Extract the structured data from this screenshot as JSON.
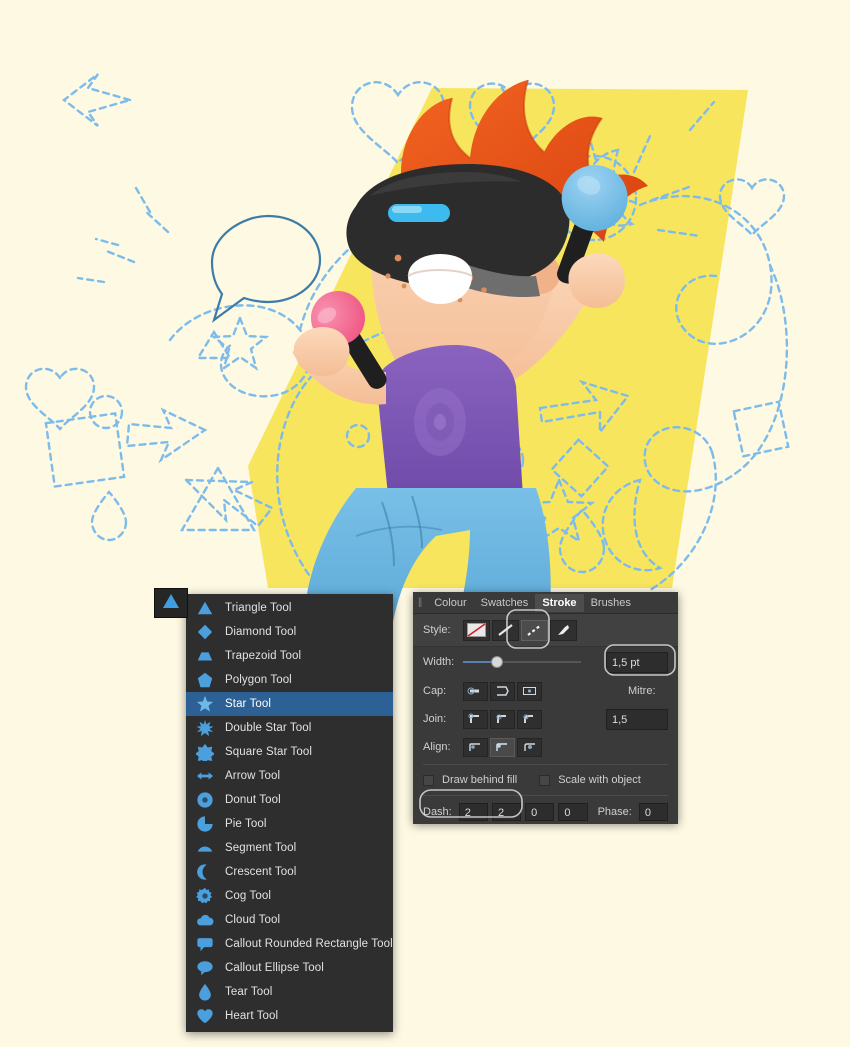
{
  "app": {
    "background_color": "#fdf9e3",
    "accent_yellow": "#f7e35a",
    "dash_stroke_color": "#79b8e8"
  },
  "illustration": {
    "name": "vr-kid-illustration",
    "alt": "Cartoon red-haired boy wearing a VR headset holding two maracas on a yellow backdrop with dashed vector shapes",
    "colors": {
      "backdrop": "#f7e35a",
      "hair": "#e8521f",
      "skin": "#f7c9a8",
      "shirt": "#7e58b5",
      "jeans": "#6bb6e0",
      "headset": "#2b2b2b",
      "visor": "#39b7e8",
      "maraca_pink": "#f2688f",
      "maraca_blue": "#6fbce8",
      "dashes": "#79b8e8"
    }
  },
  "tool_button": {
    "name": "shape-tool-button",
    "icon": "triangle-icon",
    "tooltip": "Triangle Tool"
  },
  "tool_menu": {
    "name": "shape-tools-flyout",
    "selected": "Star Tool",
    "items": [
      {
        "label": "Triangle Tool",
        "icon": "triangle-icon",
        "selected": false
      },
      {
        "label": "Diamond Tool",
        "icon": "diamond-icon",
        "selected": false
      },
      {
        "label": "Trapezoid Tool",
        "icon": "trapezoid-icon",
        "selected": false
      },
      {
        "label": "Polygon Tool",
        "icon": "pentagon-icon",
        "selected": false
      },
      {
        "label": "Star Tool",
        "icon": "star-icon",
        "selected": true
      },
      {
        "label": "Double Star Tool",
        "icon": "double-star-icon",
        "selected": false
      },
      {
        "label": "Square Star Tool",
        "icon": "square-star-icon",
        "selected": false
      },
      {
        "label": "Arrow Tool",
        "icon": "arrow-icon",
        "selected": false
      },
      {
        "label": "Donut Tool",
        "icon": "donut-icon",
        "selected": false
      },
      {
        "label": "Pie Tool",
        "icon": "pie-icon",
        "selected": false
      },
      {
        "label": "Segment Tool",
        "icon": "segment-icon",
        "selected": false
      },
      {
        "label": "Crescent Tool",
        "icon": "crescent-icon",
        "selected": false
      },
      {
        "label": "Cog Tool",
        "icon": "cog-icon",
        "selected": false
      },
      {
        "label": "Cloud Tool",
        "icon": "cloud-icon",
        "selected": false
      },
      {
        "label": "Callout Rounded Rectangle Tool",
        "icon": "callout-rounded-rect-icon",
        "selected": false
      },
      {
        "label": "Callout Ellipse Tool",
        "icon": "callout-ellipse-icon",
        "selected": false
      },
      {
        "label": "Tear Tool",
        "icon": "tear-icon",
        "selected": false
      },
      {
        "label": "Heart Tool",
        "icon": "heart-icon",
        "selected": false
      }
    ]
  },
  "stroke_panel": {
    "name": "stroke-panel",
    "tabs": [
      {
        "label": "Colour",
        "active": false
      },
      {
        "label": "Swatches",
        "active": false
      },
      {
        "label": "Stroke",
        "active": true
      },
      {
        "label": "Brushes",
        "active": false
      }
    ],
    "style": {
      "label": "Style:",
      "options": [
        {
          "name": "no-stroke-style",
          "active": false
        },
        {
          "name": "solid-stroke-style",
          "active": false
        },
        {
          "name": "dashed-stroke-style",
          "active": true
        },
        {
          "name": "brush-stroke-style",
          "active": false
        }
      ]
    },
    "width": {
      "label": "Width:",
      "value": "1,5 pt",
      "slider_percent": 28
    },
    "cap": {
      "label": "Cap:",
      "options": [
        {
          "name": "butt-cap",
          "active": false
        },
        {
          "name": "round-cap",
          "active": false
        },
        {
          "name": "square-cap",
          "active": false
        }
      ]
    },
    "join": {
      "label": "Join:",
      "options": [
        {
          "name": "miter-join",
          "active": false
        },
        {
          "name": "round-join",
          "active": false
        },
        {
          "name": "bevel-join",
          "active": false
        }
      ]
    },
    "align": {
      "label": "Align:",
      "options": [
        {
          "name": "align-center",
          "active": false
        },
        {
          "name": "align-inside",
          "active": true
        },
        {
          "name": "align-outside",
          "active": false
        }
      ]
    },
    "mitre": {
      "label": "Mitre:",
      "value": "1,5"
    },
    "checkboxes": [
      {
        "label": "Draw behind fill",
        "checked": false
      },
      {
        "label": "Scale with object",
        "checked": false
      }
    ],
    "dash": {
      "label": "Dash:",
      "values": [
        "2",
        "2",
        "0",
        "0"
      ],
      "phase_label": "Phase:",
      "phase_value": "0"
    },
    "highlighted_controls": [
      "dashed-stroke-style",
      "width-value-field",
      "dash-fields"
    ]
  }
}
